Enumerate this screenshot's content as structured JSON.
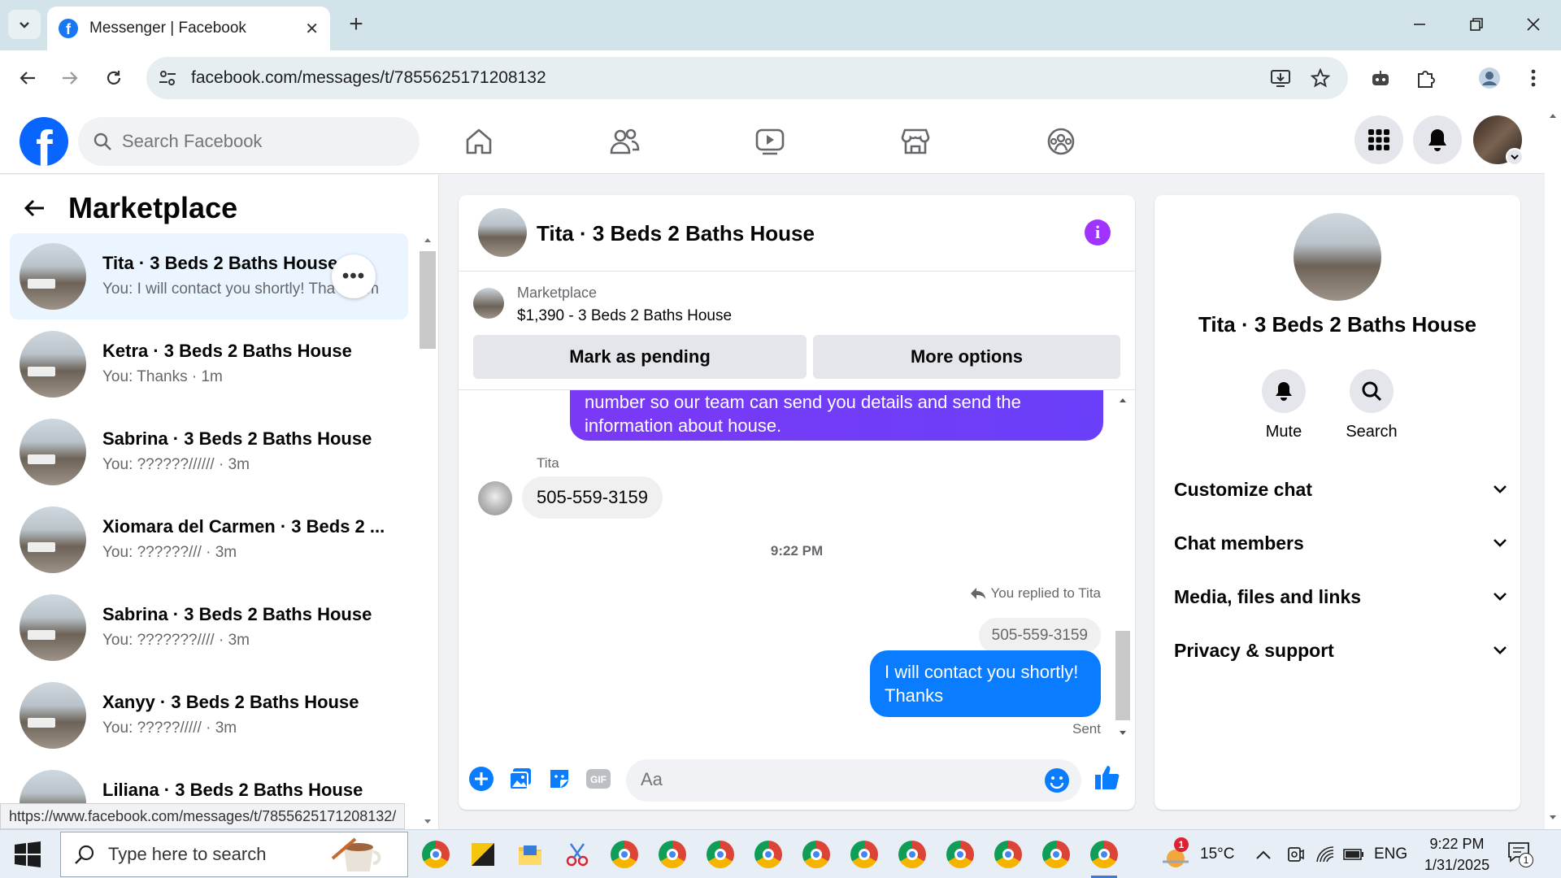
{
  "browser": {
    "tab_title": "Messenger | Facebook",
    "url": "facebook.com/messages/t/7855625171208132",
    "status_url": "https://www.facebook.com/messages/t/7855625171208132/"
  },
  "header": {
    "search_placeholder": "Search Facebook"
  },
  "sidebar": {
    "title": "Marketplace",
    "conversations": [
      {
        "name": "Tita · 3 Beds 2 Baths House",
        "preview": "You: I will contact you shortly! Tha",
        "preview_tail": "m",
        "active": true
      },
      {
        "name": "Ketra · 3 Beds 2 Baths House",
        "preview": "You: Thanks · 1m"
      },
      {
        "name": "Sabrina · 3 Beds 2 Baths House",
        "preview": "You: ??????////// · 3m"
      },
      {
        "name": "Xiomara del Carmen · 3 Beds 2 ...",
        "preview": "You: ??????/// · 3m"
      },
      {
        "name": "Sabrina · 3 Beds 2 Baths House",
        "preview": "You: ???????//// · 3m"
      },
      {
        "name": "Xanyy · 3 Beds 2 Baths House",
        "preview": "You: ?????///// · 3m"
      },
      {
        "name": "Liliana · 3 Beds 2 Baths House",
        "preview": ""
      }
    ]
  },
  "chat": {
    "title": "Tita · 3 Beds 2 Baths House",
    "marketplace_label": "Marketplace",
    "listing": "$1,390 - 3 Beds 2 Baths House",
    "mark_pending": "Mark as pending",
    "more_options": "More options",
    "messages": {
      "outgoing_partial": "number so our team can send you details and send the information about house.",
      "sender": "Tita",
      "incoming": "505-559-3159",
      "timestamp": "9:22 PM",
      "replied_label": "You replied to Tita",
      "quoted": "505-559-3159",
      "outgoing": "I will contact you shortly! Thanks",
      "status": "Sent"
    },
    "composer_placeholder": "Aa",
    "gif_label": "GIF"
  },
  "info_panel": {
    "name": "Tita · 3 Beds 2 Baths House",
    "mute": "Mute",
    "search": "Search",
    "sections": [
      "Customize chat",
      "Chat members",
      "Media, files and links",
      "Privacy & support"
    ]
  },
  "taskbar": {
    "search_placeholder": "Type here to search",
    "weather": "15°C",
    "weather_badge": "1",
    "language": "ENG",
    "time": "9:22 PM",
    "date": "1/31/2025",
    "notif_count": "1"
  },
  "colors": {
    "fb_blue": "#0866ff",
    "messenger_blue": "#0a7cff",
    "purple": "#7a39f5",
    "info": "#a033ff"
  }
}
